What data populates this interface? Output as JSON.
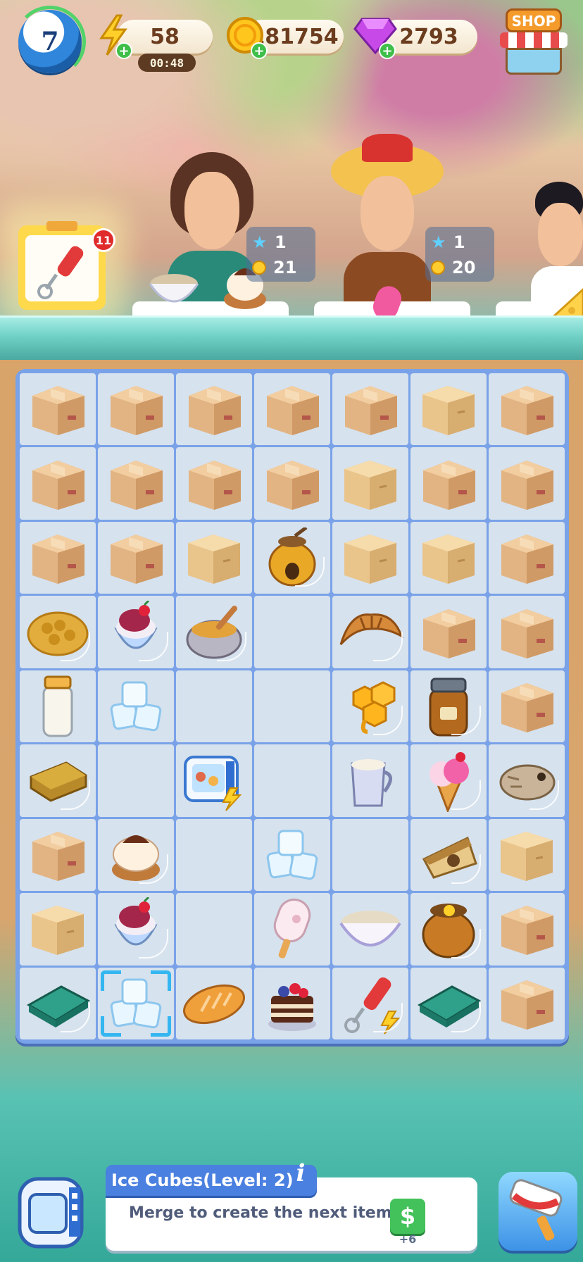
{
  "hud": {
    "level": "7",
    "energy": "58",
    "energy_timer": "00:48",
    "coins": "181754",
    "gems": "2793",
    "shop_label": "SHOP"
  },
  "orders": {
    "clipboard_count": "11",
    "customers": [
      {
        "name_icon": "customer-woman-glasses",
        "stars": "1",
        "coins": "21"
      },
      {
        "name_icon": "customer-woman-hat",
        "stars": "1",
        "coins": "20"
      },
      {
        "name_icon": "customer-man"
      }
    ]
  },
  "board": {
    "rows": [
      [
        "box",
        "box",
        "box",
        "box",
        "box",
        "box-closed",
        "box"
      ],
      [
        "box",
        "box",
        "box",
        "box",
        "box-closed",
        "box",
        "box"
      ],
      [
        "box",
        "box",
        "box-closed",
        "honey-pot",
        "box-closed",
        "box-closed",
        "box"
      ],
      [
        "honeycomb",
        "ice-cream-cup",
        "honey-bowl",
        "empty",
        "croissant",
        "box",
        "box"
      ],
      [
        "milk-jar",
        "ice-cubes",
        "empty",
        "empty",
        "honeycomb-piece",
        "honey-jar",
        "box"
      ],
      [
        "soap-bar",
        "empty",
        "dessert-fridge",
        "empty",
        "milk-jug",
        "ice-cream-cone",
        "bee-larva"
      ],
      [
        "box",
        "cream-cake",
        "empty",
        "ice-cubes",
        "empty",
        "cheesecake-slice",
        "box-closed"
      ],
      [
        "box-closed",
        "ice-cream-cup",
        "empty",
        "popsicle",
        "porridge-bowl",
        "honey-pot-jar",
        "box"
      ],
      [
        "tray-container",
        "ice-cubes",
        "bread-loaf",
        "layer-cake",
        "hand-mixer",
        "tray-container",
        "box"
      ]
    ],
    "selected_cell": "8-1"
  },
  "info": {
    "title": "Ice Cubes(Level: 2)",
    "info_icon": "i",
    "description": "Merge to create the next item.",
    "sell_label": "$",
    "sell_amount": "+6"
  },
  "colors": {
    "accent": "#4a80e0",
    "board": "#7aa2e8",
    "cell": "#d6e2ee",
    "sell": "#43c15a"
  }
}
